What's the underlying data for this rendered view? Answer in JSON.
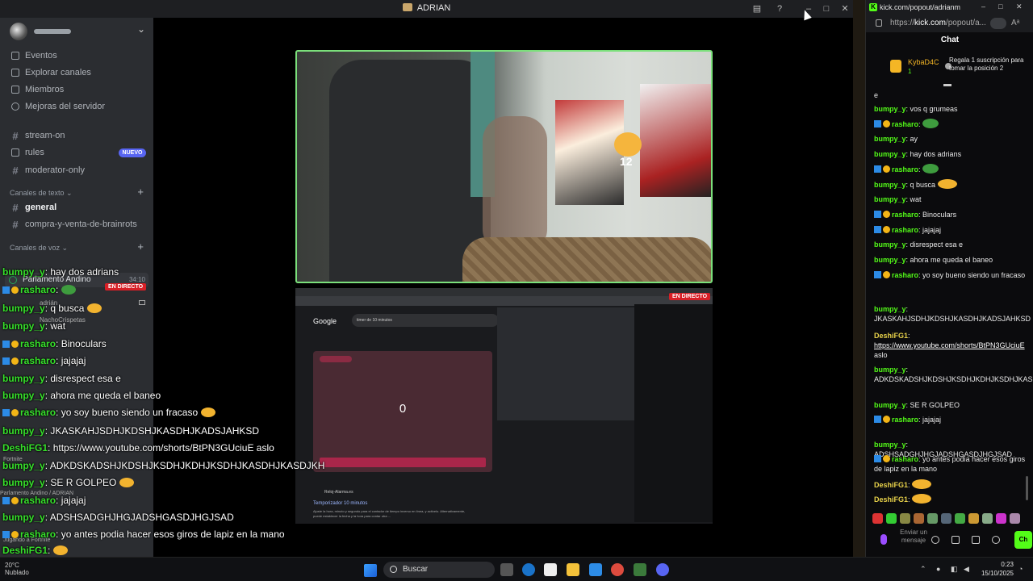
{
  "discord": {
    "window_title": "ADRIAN",
    "nav": [
      {
        "label": "Eventos",
        "icon": "calendar-icon"
      },
      {
        "label": "Explorar canales",
        "icon": "explore-icon"
      },
      {
        "label": "Miembros",
        "icon": "members-icon"
      },
      {
        "label": "Mejoras del servidor",
        "icon": "boost-icon"
      }
    ],
    "channels_top": [
      {
        "label": "stream-on"
      },
      {
        "label": "rules",
        "badge": "NUEVO"
      },
      {
        "label": "moderator-only"
      }
    ],
    "text_category": "Canales de texto",
    "text_channels": [
      "general",
      "compra-y-venta-de-brainrots"
    ],
    "voice_category": "Canales de voz",
    "voice_channel": {
      "name": "Parlamento Andino",
      "time": "34:10"
    },
    "voice_users": [
      "adrián",
      "NachoCrispetas"
    ],
    "voice_footer": "Parlamento Andino / ADRIAN",
    "activity": [
      "Jugando a Fortnite",
      "Fortnite"
    ],
    "live_label": "EN DIRECTO"
  },
  "stream": {
    "cam_number": "12",
    "screen": {
      "google_label": "Google",
      "search_text": "timer de 10 minutos",
      "timer_value": "0",
      "result_site": "Reloj-Alarma.es",
      "result_title": "Temporizador 10 minutos",
      "result_snippet": "Ajuste la hora, minuto y segundo para el contador de tiempo inverso en línea, y activelo. Alternativamente, puede establecer la fecha y la hora para contar otra ..."
    }
  },
  "overlay_chat": [
    {
      "user": "bumpy_y",
      "text": "hay dos adrians",
      "badges": false
    },
    {
      "user": "rasharo",
      "text": "",
      "badges": true,
      "emote": "pepe"
    },
    {
      "user": "bumpy_y",
      "text": "q busca",
      "badges": false,
      "emote": "emo"
    },
    {
      "user": "bumpy_y",
      "text": "wat",
      "badges": false
    },
    {
      "user": "rasharo",
      "text": "Binoculars",
      "badges": true
    },
    {
      "user": "rasharo",
      "text": "jajajaj",
      "badges": true
    },
    {
      "user": "bumpy_y",
      "text": "disrespect esa e",
      "badges": false
    },
    {
      "user": "bumpy_y",
      "text": "ahora me queda el baneo",
      "badges": false
    },
    {
      "user": "rasharo",
      "text": "yo soy bueno siendo un fracaso",
      "badges": true,
      "emote": "emo"
    },
    {
      "user": "bumpy_y",
      "text": "JKASKAHJSDHJKDSHJKASDHJKADSJAHKSD",
      "badges": false
    },
    {
      "user": "DeshiFG1",
      "text": "https://www.youtube.com/shorts/BtPN3GUciuE aslo",
      "badges": false
    },
    {
      "user": "bumpy_y",
      "text": "ADKDSKADSHJKDSHJKSDHJKDHJKSDHJKASDHJKASDJKH",
      "badges": false
    },
    {
      "user": "bumpy_y",
      "text": "SE R GOLPEO",
      "badges": false,
      "emote": "img"
    },
    {
      "user": "rasharo",
      "text": "jajajaj",
      "badges": true
    },
    {
      "user": "bumpy_y",
      "text": "ADSHSADGHJHGJADSHGASDJHGJSAD",
      "badges": false
    },
    {
      "user": "rasharo",
      "text": "yo antes podia hacer esos giros de lapiz en la mano",
      "badges": true
    },
    {
      "user": "DeshiFG1",
      "text": "",
      "badges": false,
      "emote": "emo"
    },
    {
      "user": "DeshiFG1",
      "text": "",
      "badges": false,
      "emote": "emo"
    }
  ],
  "weather": {
    "temp": "20°C",
    "desc": "Nublado"
  },
  "kick": {
    "window_title": "kick.com/popout/adrianmts...",
    "url_prefix": "https://",
    "url_host": "kick.com",
    "url_rest": "/popout/a...",
    "chat_title": "Chat",
    "pinned": {
      "user": "KybaD4C",
      "count": "1",
      "message": "Regala 1 suscripción para tomar la posición 2"
    },
    "messages": [
      {
        "user": "",
        "text": "e"
      },
      {
        "user": "bumpy_y",
        "text": "vos q grumeas"
      },
      {
        "user": "rasharo",
        "text": "",
        "badges": true,
        "emote": "pepe"
      },
      {
        "user": "bumpy_y",
        "text": "ay"
      },
      {
        "user": "bumpy_y",
        "text": "hay dos adrians"
      },
      {
        "user": "rasharo",
        "text": "",
        "badges": true,
        "emote": "pepe"
      },
      {
        "user": "bumpy_y",
        "text": "q busca",
        "emote": "emo"
      },
      {
        "user": "bumpy_y",
        "text": "wat"
      },
      {
        "user": "rasharo",
        "text": "Binoculars",
        "badges": true
      },
      {
        "user": "rasharo",
        "text": "jajajaj",
        "badges": true
      },
      {
        "user": "bumpy_y",
        "text": "disrespect esa e"
      },
      {
        "user": "bumpy_y",
        "text": "ahora me queda el baneo"
      },
      {
        "user": "rasharo",
        "text": "yo soy bueno siendo un fracaso",
        "badges": true
      },
      {
        "user": "bumpy_y",
        "text": "JKASKAHJSDHJKDSHJKASDHJKADSJAHKSD"
      },
      {
        "user": "DeshiFG1",
        "link": "https://www.youtube.com/shorts/BtPN3GUciuE",
        "text": "aslo"
      },
      {
        "user": "bumpy_y",
        "text": "ADKDSKADSHJKDSHJKSDHJKDHJKSDHJKASDHJKASDJKH"
      },
      {
        "user": "bumpy_y",
        "text": "SE R GOLPEO"
      },
      {
        "user": "rasharo",
        "text": "jajajaj",
        "badges": true
      },
      {
        "user": "bumpy_y",
        "text": "ADSHSADGHJHGJADSHGASDJHGJSAD"
      },
      {
        "user": "rasharo",
        "text": "yo antes podia hacer esos giros de lapiz en la mano",
        "badges": true
      },
      {
        "user": "DeshiFG1",
        "text": "",
        "emote": "emo"
      },
      {
        "user": "DeshiFG1",
        "text": "",
        "emote": "emo"
      }
    ],
    "input_placeholder": "Enviar un mensaje",
    "send_label": "Ch"
  },
  "taskbar": {
    "search": "Buscar",
    "time": "0:23",
    "date": "15/10/2025"
  }
}
